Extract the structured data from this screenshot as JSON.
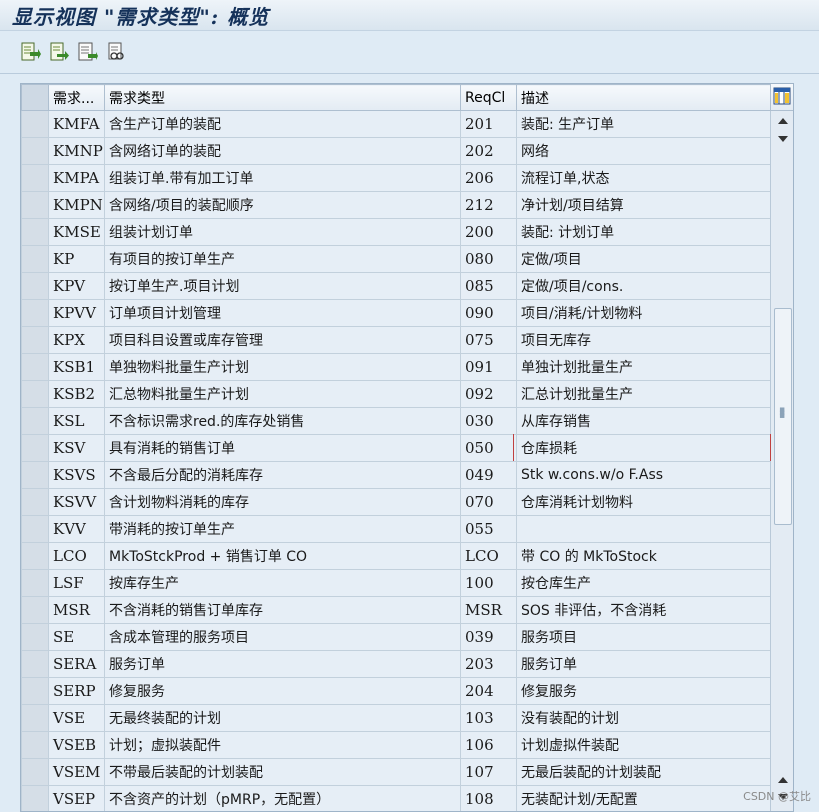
{
  "window": {
    "title": "显示视图 \"需求类型\": 概览"
  },
  "toolbar": {
    "buttons": [
      {
        "icon": "export-icon"
      },
      {
        "icon": "select-all-icon"
      },
      {
        "icon": "details-icon"
      },
      {
        "icon": "print-preview-icon"
      }
    ]
  },
  "table": {
    "headers": [
      "需求...",
      "需求类型",
      "ReqCl",
      "描述"
    ],
    "rows": [
      {
        "code": "KMFA",
        "type": "含生产订单的装配",
        "reqcl": "201",
        "desc": "装配: 生产订单"
      },
      {
        "code": "KMNP",
        "type": "含网络订单的装配",
        "reqcl": "202",
        "desc": "网络"
      },
      {
        "code": "KMPA",
        "type": "组装订单.带有加工订单",
        "reqcl": "206",
        "desc": "流程订单,状态"
      },
      {
        "code": "KMPN",
        "type": "含网络/项目的装配顺序",
        "reqcl": "212",
        "desc": "净计划/项目结算"
      },
      {
        "code": "KMSE",
        "type": "组装计划订单",
        "reqcl": "200",
        "desc": "装配: 计划订单"
      },
      {
        "code": "KP",
        "type": "有项目的按订单生产",
        "reqcl": "080",
        "desc": "定做/项目"
      },
      {
        "code": "KPV",
        "type": "按订单生产.项目计划",
        "reqcl": "085",
        "desc": "定做/项目/cons."
      },
      {
        "code": "KPVV",
        "type": "订单项目计划管理",
        "reqcl": "090",
        "desc": "项目/消耗/计划物料"
      },
      {
        "code": "KPX",
        "type": "项目科目设置或库存管理",
        "reqcl": "075",
        "desc": "项目无库存"
      },
      {
        "code": "KSB1",
        "type": "单独物料批量生产计划",
        "reqcl": "091",
        "desc": "单独计划批量生产"
      },
      {
        "code": "KSB2",
        "type": "汇总物料批量生产计划",
        "reqcl": "092",
        "desc": "汇总计划批量生产"
      },
      {
        "code": "KSL",
        "type": "不含标识需求red.的库存处销售",
        "reqcl": "030",
        "desc": "从库存销售"
      },
      {
        "code": "KSV",
        "type": "具有消耗的销售订单",
        "reqcl": "050",
        "desc": "仓库损耗"
      },
      {
        "code": "KSVS",
        "type": "不含最后分配的消耗库存",
        "reqcl": "049",
        "desc": "Stk w.cons.w/o F.Ass"
      },
      {
        "code": "KSVV",
        "type": "含计划物料消耗的库存",
        "reqcl": "070",
        "desc": "仓库消耗计划物料"
      },
      {
        "code": "KVV",
        "type": "带消耗的按订单生产",
        "reqcl": "055",
        "desc": ""
      },
      {
        "code": "LCO",
        "type": "MkToStckProd + 销售订单 CO",
        "reqcl": "LCO",
        "desc": "带 CO 的 MkToStock"
      },
      {
        "code": "LSF",
        "type": "按库存生产",
        "reqcl": "100",
        "desc": "按仓库生产"
      },
      {
        "code": "MSR",
        "type": "不含消耗的销售订单库存",
        "reqcl": "MSR",
        "desc": "SOS 非评估，不含消耗"
      },
      {
        "code": "SE",
        "type": "含成本管理的服务项目",
        "reqcl": "039",
        "desc": "服务项目"
      },
      {
        "code": "SERA",
        "type": "服务订单",
        "reqcl": "203",
        "desc": "服务订单"
      },
      {
        "code": "SERP",
        "type": "修复服务",
        "reqcl": "204",
        "desc": "修复服务"
      },
      {
        "code": "VSE",
        "type": "无最终装配的计划",
        "reqcl": "103",
        "desc": "没有装配的计划"
      },
      {
        "code": "VSEB",
        "type": "计划；虚拟装配件",
        "reqcl": "106",
        "desc": "计划虚拟件装配"
      },
      {
        "code": "VSEM",
        "type": "不带最后装配的计划装配",
        "reqcl": "107",
        "desc": "无最后装配的计划装配"
      },
      {
        "code": "VSEP",
        "type": "不含资产的计划（pMRP，无配置）",
        "reqcl": "108",
        "desc": "无装配计划/无配置"
      }
    ]
  },
  "watermark": "CSDN @艾比"
}
